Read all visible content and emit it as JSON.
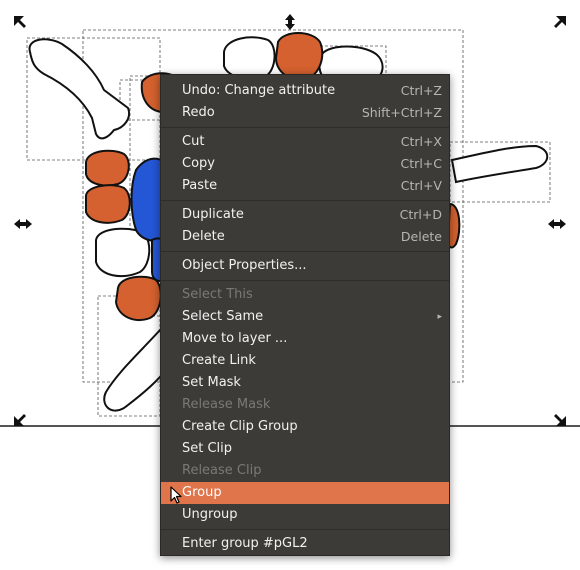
{
  "context_menu": {
    "items": [
      {
        "label": "Undo: Change attribute",
        "shortcut": "Ctrl+Z"
      },
      {
        "label": "Redo",
        "shortcut": "Shift+Ctrl+Z"
      },
      {
        "label": "Cut",
        "shortcut": "Ctrl+X"
      },
      {
        "label": "Copy",
        "shortcut": "Ctrl+C"
      },
      {
        "label": "Paste",
        "shortcut": "Ctrl+V"
      },
      {
        "label": "Duplicate",
        "shortcut": "Ctrl+D"
      },
      {
        "label": "Delete",
        "shortcut": "Delete"
      },
      {
        "label": "Object Properties..."
      },
      {
        "label": "Select This",
        "disabled": true
      },
      {
        "label": "Select Same",
        "submenu": true
      },
      {
        "label": "Move to layer ..."
      },
      {
        "label": "Create Link"
      },
      {
        "label": "Set Mask"
      },
      {
        "label": "Release Mask",
        "disabled": true
      },
      {
        "label": "Create Clip Group"
      },
      {
        "label": "Set Clip"
      },
      {
        "label": "Release Clip",
        "disabled": true
      },
      {
        "label": "Group",
        "highlighted": true
      },
      {
        "label": "Ungroup"
      },
      {
        "label": "Enter group #pGL2"
      }
    ]
  },
  "colors": {
    "shape_orange": "#d4612f",
    "shape_blue": "#2457d6",
    "menu_bg": "#3c3b37",
    "menu_highlight": "#e0744a"
  }
}
